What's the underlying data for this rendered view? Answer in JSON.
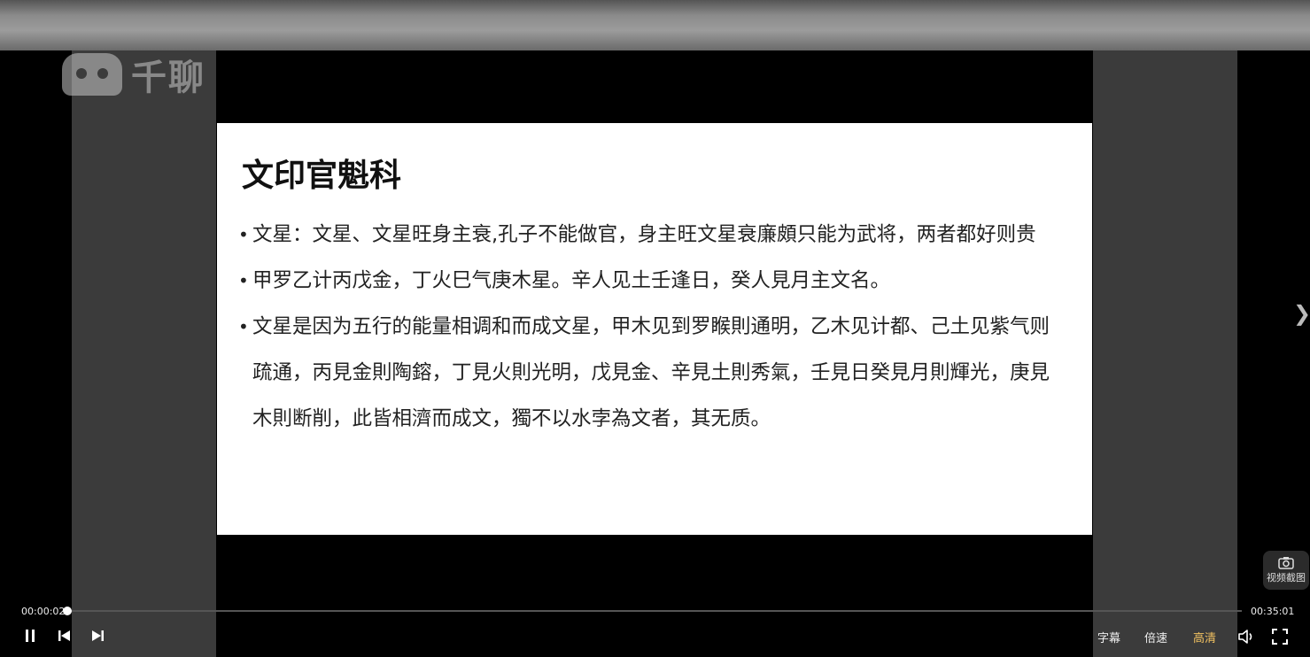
{
  "watermark": {
    "logo_text": "千聊"
  },
  "slide": {
    "title": "文印官魁科",
    "bullets": [
      "文星：文星、文星旺身主衰,孔子不能做官，身主旺文星衰廉頗只能为武将，两者都好则贵",
      "甲罗乙计丙戊金，丁火巳气庚木星。辛人见土壬逢日，癸人見月主文名。",
      "文星是因为五行的能量相调和而成文星，甲木见到罗睺則通明，乙木见计都、己土见紫气则疏通，丙見金則陶鎔，丁見火則光明，戊見金、辛見土則秀氣，壬見日癸見月則輝光，庚見木則断削，此皆相濟而成文，獨不以水孛為文者，其无质。"
    ]
  },
  "screenshot_button": {
    "label": "视频截图",
    "icon": "camera-icon"
  },
  "player": {
    "current_time": "00:00:02",
    "total_time": "00:35:01",
    "progress": 0.001,
    "subtitle_label": "字幕",
    "speed_label": "倍速",
    "quality_label": "高清",
    "quality_color": "#f0c060",
    "icons": [
      "pause-icon",
      "previous-icon",
      "next-icon",
      "volume-icon",
      "fullscreen-icon",
      "chevron-right-icon"
    ]
  }
}
